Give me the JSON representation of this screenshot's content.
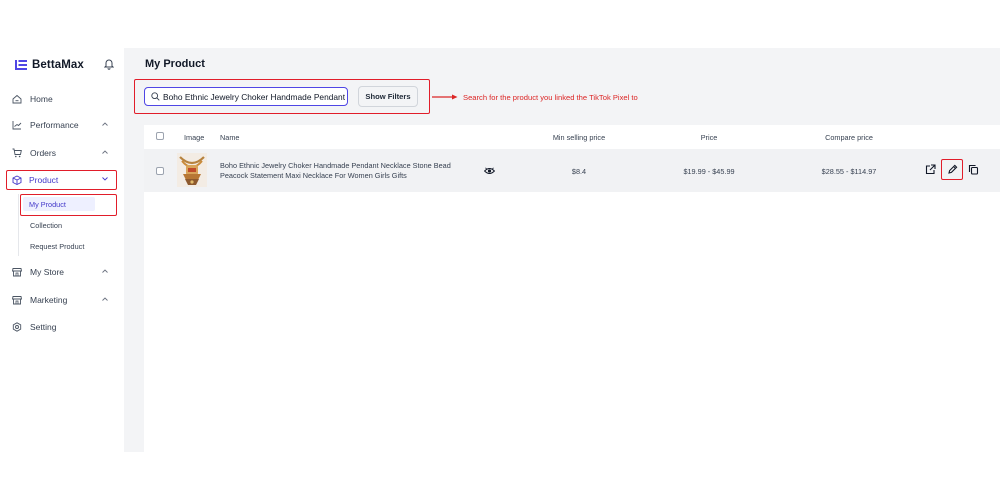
{
  "brand": {
    "name": "BettaMax"
  },
  "sidebar": {
    "items": [
      {
        "label": "Home",
        "icon": "home-icon"
      },
      {
        "label": "Performance",
        "icon": "chart-icon"
      },
      {
        "label": "Orders",
        "icon": "cart-icon"
      },
      {
        "label": "Product",
        "icon": "box-icon",
        "active": true
      },
      {
        "label": "My Store",
        "icon": "store-icon"
      },
      {
        "label": "Marketing",
        "icon": "store-icon"
      },
      {
        "label": "Setting",
        "icon": "gear-icon"
      }
    ],
    "product_sub": [
      {
        "label": "My Product",
        "active": true
      },
      {
        "label": "Collection"
      },
      {
        "label": "Request Product"
      }
    ]
  },
  "main": {
    "title": "My Product",
    "search": {
      "value": "Boho Ethnic Jewelry Choker Handmade Pendant Necklace Stone Bead"
    },
    "filter_label": "Show Filters",
    "annotation": "Search for the product you linked the TikTok Pixel to"
  },
  "table": {
    "headers": {
      "image": "Image",
      "name": "Name",
      "min_price": "Min selling price",
      "price": "Price",
      "compare": "Compare price"
    },
    "rows": [
      {
        "name_line1": "Boho Ethnic Jewelry Choker Handmade Pendant Necklace Stone Bead",
        "name_line2": "Peacock Statement Maxi Necklace For Women Girls Gifts",
        "min_price": "$8.4",
        "price": "$19.99 - $45.99",
        "compare": "$28.55 - $114.97"
      }
    ]
  },
  "colors": {
    "accent": "#4f46e5",
    "highlight": "#e11d2a",
    "annotation": "#dc2626"
  }
}
